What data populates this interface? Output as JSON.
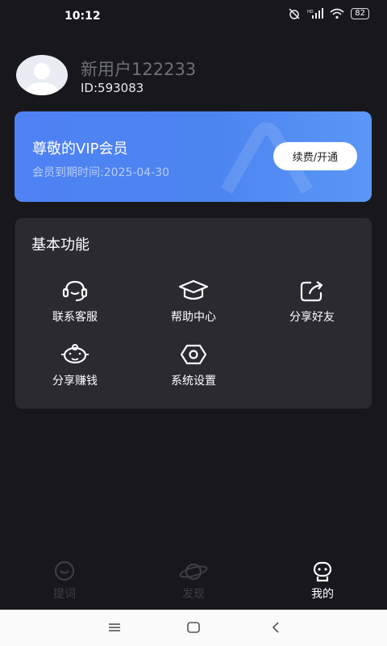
{
  "status_bar": {
    "time": "10:12",
    "battery": "82",
    "icons": [
      "alarm-off-icon",
      "hd-signal-icon",
      "wifi-icon",
      "battery-icon"
    ]
  },
  "profile": {
    "username": "新用户122233",
    "user_id": "ID:593083",
    "avatar_icon": "default-avatar-icon"
  },
  "vip": {
    "title": "尊敬的VIP会员",
    "expire": "会员到期时间:2025-04-30",
    "button": "续费/开通",
    "accent": "#4f82f4"
  },
  "functions": {
    "title": "基本功能",
    "items": [
      {
        "label": "联系客服",
        "icon": "headset-icon"
      },
      {
        "label": "帮助中心",
        "icon": "graduation-cap-icon"
      },
      {
        "label": "分享好友",
        "icon": "share-box-icon"
      },
      {
        "label": "分享赚钱",
        "icon": "piggy-bank-icon"
      },
      {
        "label": "系统设置",
        "icon": "settings-eye-icon"
      }
    ]
  },
  "tabbar": {
    "tabs": [
      {
        "label": "提词",
        "icon": "prompt-bubble-icon",
        "active": false
      },
      {
        "label": "发现",
        "icon": "planet-icon",
        "active": false
      },
      {
        "label": "我的",
        "icon": "robot-face-icon",
        "active": true
      }
    ]
  },
  "navbar": {
    "icons": [
      "menu-icon",
      "home-square-icon",
      "back-chevron-icon"
    ]
  }
}
